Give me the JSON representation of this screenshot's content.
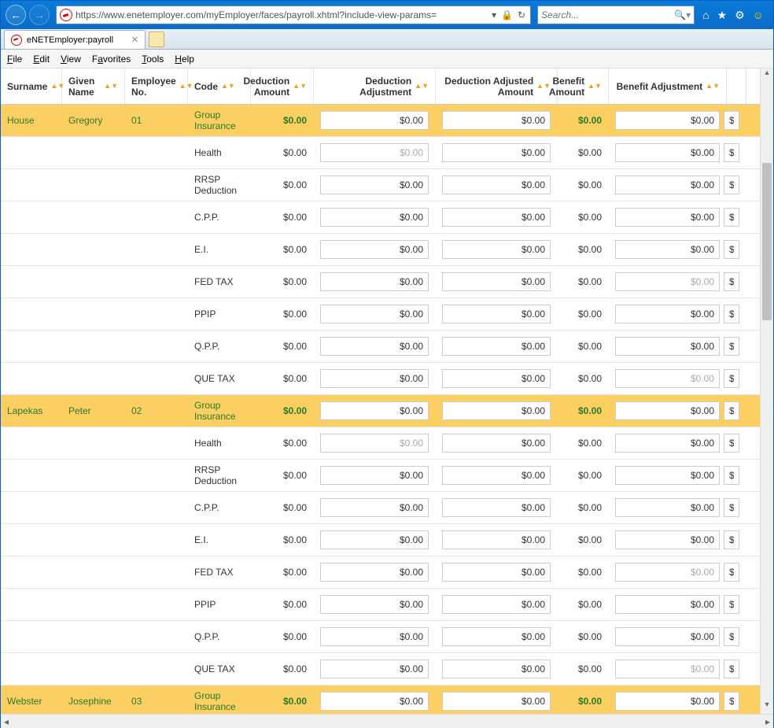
{
  "browser": {
    "url": "https://www.enetemployer.com/myEmployer/faces/payroll.xhtml?include-view-params=",
    "search_placeholder": "Search...",
    "tab_title": "eNETEmployer:payroll"
  },
  "menus": [
    "File",
    "Edit",
    "View",
    "Favorites",
    "Tools",
    "Help"
  ],
  "columns": {
    "surname": "Surname",
    "given": "Given Name",
    "empno": "Employee No.",
    "code": "Code",
    "damt": "Deduction Amount",
    "dadj": "Deduction Adjustment",
    "dadjamt": "Deduction Adjusted Amount",
    "bamt": "Benefit Amount",
    "badj": "Benefit Adjustment"
  },
  "employees": [
    {
      "surname": "House",
      "given": "Gregory",
      "empno": "01"
    },
    {
      "surname": "Lapekas",
      "given": "Peter",
      "empno": "02"
    },
    {
      "surname": "Webster",
      "given": "Josephine",
      "empno": "03"
    }
  ],
  "group_code": "Group Insurance",
  "sub_codes": [
    "Health",
    "RRSP Deduction",
    "C.P.P.",
    "E.I.",
    "FED TAX",
    "PPIP",
    "Q.P.P.",
    "QUE TAX"
  ],
  "zero": "$0.00",
  "dim_rows": {
    "Health": [
      "dadj"
    ],
    "FED TAX": [
      "badj"
    ],
    "QUE TAX": [
      "badj"
    ]
  }
}
